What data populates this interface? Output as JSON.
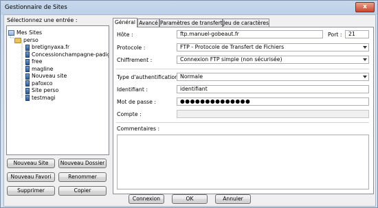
{
  "window": {
    "title": "Gestionnaire de Sites",
    "close_label": "x"
  },
  "left": {
    "select_label": "Sélectionnez une entrée :",
    "tree": [
      {
        "label": "Mes Sites",
        "icon": "my-sites-icon",
        "level": 0
      },
      {
        "label": "perso",
        "icon": "folder-icon",
        "level": 1
      },
      {
        "label": "bretignyaxa.fr",
        "icon": "server-icon",
        "level": 2
      },
      {
        "label": "Concessionchampagne-padig",
        "icon": "server-icon",
        "level": 2
      },
      {
        "label": "free",
        "icon": "server-icon",
        "level": 2
      },
      {
        "label": "magline",
        "icon": "server-icon",
        "level": 2
      },
      {
        "label": "Nouveau site",
        "icon": "server-icon",
        "level": 2
      },
      {
        "label": "pafoxco",
        "icon": "server-icon",
        "level": 2
      },
      {
        "label": "Site perso",
        "icon": "server-icon",
        "level": 2
      },
      {
        "label": "testmagi",
        "icon": "server-icon",
        "level": 2
      }
    ],
    "buttons": {
      "new_site": "Nouveau Site",
      "new_folder": "Nouveau Dossier",
      "new_favorite": "Nouveau Favori",
      "rename": "Renommer",
      "delete": "Supprimer",
      "copy": "Copier"
    }
  },
  "tabs": [
    "Général",
    "Avancé",
    "Paramètres de transfert",
    "Jeu de caractères"
  ],
  "general": {
    "host_label": "Hôte :",
    "host_value": "ftp.manuel-gobeaut.fr",
    "port_label": "Port :",
    "port_value": "21",
    "protocol_label": "Protocole :",
    "protocol_value": "FTP - Protocole de Transfert de Fichiers",
    "encryption_label": "Chiffrement :",
    "encryption_value": "Connexion FTP simple (non sécurisée)",
    "auth_label": "Type d'authentification :",
    "auth_value": "Normale",
    "user_label": "Identifiant :",
    "user_value": "identifiant",
    "password_label": "Mot de passe :",
    "password_value": "●●●●●●●●●●●●●●",
    "account_label": "Compte :",
    "account_value": "",
    "comments_label": "Commentaires :"
  },
  "footer": {
    "connect": "Connexion",
    "ok": "OK",
    "cancel": "Annuler"
  }
}
